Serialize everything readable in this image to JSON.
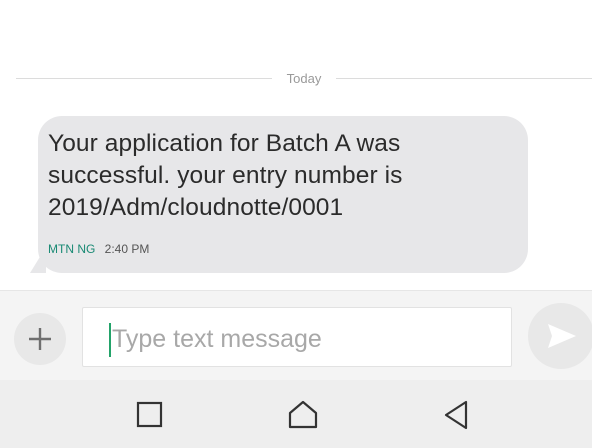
{
  "conversation": {
    "date_divider": "Today",
    "messages": [
      {
        "text": "Your application for Batch A was\nsuccessful. your entry number is\n2019/Adm/cloudnotte/0001",
        "sender": "MTN NG",
        "time": "2:40 PM",
        "direction": "incoming"
      }
    ]
  },
  "compose": {
    "attach_icon": "plus-icon",
    "placeholder": "Type text message",
    "value": "",
    "send_icon": "send-arrow-icon"
  },
  "nav_bar": {
    "buttons": [
      "recents-square-icon",
      "home-house-icon",
      "back-triangle-icon"
    ]
  },
  "colors": {
    "bubble": "#e7e7e9",
    "sender_accent": "#1a8a74",
    "cursor": "#23a36a"
  }
}
